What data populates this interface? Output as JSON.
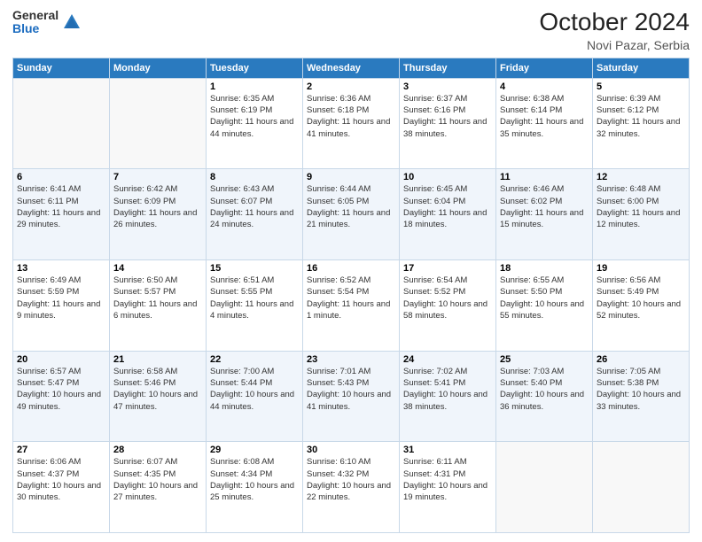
{
  "logo": {
    "general": "General",
    "blue": "Blue"
  },
  "title": "October 2024",
  "subtitle": "Novi Pazar, Serbia",
  "days_of_week": [
    "Sunday",
    "Monday",
    "Tuesday",
    "Wednesday",
    "Thursday",
    "Friday",
    "Saturday"
  ],
  "weeks": [
    [
      {
        "day": "",
        "sunrise": "",
        "sunset": "",
        "daylight": ""
      },
      {
        "day": "",
        "sunrise": "",
        "sunset": "",
        "daylight": ""
      },
      {
        "day": "1",
        "sunrise": "Sunrise: 6:35 AM",
        "sunset": "Sunset: 6:19 PM",
        "daylight": "Daylight: 11 hours and 44 minutes."
      },
      {
        "day": "2",
        "sunrise": "Sunrise: 6:36 AM",
        "sunset": "Sunset: 6:18 PM",
        "daylight": "Daylight: 11 hours and 41 minutes."
      },
      {
        "day": "3",
        "sunrise": "Sunrise: 6:37 AM",
        "sunset": "Sunset: 6:16 PM",
        "daylight": "Daylight: 11 hours and 38 minutes."
      },
      {
        "day": "4",
        "sunrise": "Sunrise: 6:38 AM",
        "sunset": "Sunset: 6:14 PM",
        "daylight": "Daylight: 11 hours and 35 minutes."
      },
      {
        "day": "5",
        "sunrise": "Sunrise: 6:39 AM",
        "sunset": "Sunset: 6:12 PM",
        "daylight": "Daylight: 11 hours and 32 minutes."
      }
    ],
    [
      {
        "day": "6",
        "sunrise": "Sunrise: 6:41 AM",
        "sunset": "Sunset: 6:11 PM",
        "daylight": "Daylight: 11 hours and 29 minutes."
      },
      {
        "day": "7",
        "sunrise": "Sunrise: 6:42 AM",
        "sunset": "Sunset: 6:09 PM",
        "daylight": "Daylight: 11 hours and 26 minutes."
      },
      {
        "day": "8",
        "sunrise": "Sunrise: 6:43 AM",
        "sunset": "Sunset: 6:07 PM",
        "daylight": "Daylight: 11 hours and 24 minutes."
      },
      {
        "day": "9",
        "sunrise": "Sunrise: 6:44 AM",
        "sunset": "Sunset: 6:05 PM",
        "daylight": "Daylight: 11 hours and 21 minutes."
      },
      {
        "day": "10",
        "sunrise": "Sunrise: 6:45 AM",
        "sunset": "Sunset: 6:04 PM",
        "daylight": "Daylight: 11 hours and 18 minutes."
      },
      {
        "day": "11",
        "sunrise": "Sunrise: 6:46 AM",
        "sunset": "Sunset: 6:02 PM",
        "daylight": "Daylight: 11 hours and 15 minutes."
      },
      {
        "day": "12",
        "sunrise": "Sunrise: 6:48 AM",
        "sunset": "Sunset: 6:00 PM",
        "daylight": "Daylight: 11 hours and 12 minutes."
      }
    ],
    [
      {
        "day": "13",
        "sunrise": "Sunrise: 6:49 AM",
        "sunset": "Sunset: 5:59 PM",
        "daylight": "Daylight: 11 hours and 9 minutes."
      },
      {
        "day": "14",
        "sunrise": "Sunrise: 6:50 AM",
        "sunset": "Sunset: 5:57 PM",
        "daylight": "Daylight: 11 hours and 6 minutes."
      },
      {
        "day": "15",
        "sunrise": "Sunrise: 6:51 AM",
        "sunset": "Sunset: 5:55 PM",
        "daylight": "Daylight: 11 hours and 4 minutes."
      },
      {
        "day": "16",
        "sunrise": "Sunrise: 6:52 AM",
        "sunset": "Sunset: 5:54 PM",
        "daylight": "Daylight: 11 hours and 1 minute."
      },
      {
        "day": "17",
        "sunrise": "Sunrise: 6:54 AM",
        "sunset": "Sunset: 5:52 PM",
        "daylight": "Daylight: 10 hours and 58 minutes."
      },
      {
        "day": "18",
        "sunrise": "Sunrise: 6:55 AM",
        "sunset": "Sunset: 5:50 PM",
        "daylight": "Daylight: 10 hours and 55 minutes."
      },
      {
        "day": "19",
        "sunrise": "Sunrise: 6:56 AM",
        "sunset": "Sunset: 5:49 PM",
        "daylight": "Daylight: 10 hours and 52 minutes."
      }
    ],
    [
      {
        "day": "20",
        "sunrise": "Sunrise: 6:57 AM",
        "sunset": "Sunset: 5:47 PM",
        "daylight": "Daylight: 10 hours and 49 minutes."
      },
      {
        "day": "21",
        "sunrise": "Sunrise: 6:58 AM",
        "sunset": "Sunset: 5:46 PM",
        "daylight": "Daylight: 10 hours and 47 minutes."
      },
      {
        "day": "22",
        "sunrise": "Sunrise: 7:00 AM",
        "sunset": "Sunset: 5:44 PM",
        "daylight": "Daylight: 10 hours and 44 minutes."
      },
      {
        "day": "23",
        "sunrise": "Sunrise: 7:01 AM",
        "sunset": "Sunset: 5:43 PM",
        "daylight": "Daylight: 10 hours and 41 minutes."
      },
      {
        "day": "24",
        "sunrise": "Sunrise: 7:02 AM",
        "sunset": "Sunset: 5:41 PM",
        "daylight": "Daylight: 10 hours and 38 minutes."
      },
      {
        "day": "25",
        "sunrise": "Sunrise: 7:03 AM",
        "sunset": "Sunset: 5:40 PM",
        "daylight": "Daylight: 10 hours and 36 minutes."
      },
      {
        "day": "26",
        "sunrise": "Sunrise: 7:05 AM",
        "sunset": "Sunset: 5:38 PM",
        "daylight": "Daylight: 10 hours and 33 minutes."
      }
    ],
    [
      {
        "day": "27",
        "sunrise": "Sunrise: 6:06 AM",
        "sunset": "Sunset: 4:37 PM",
        "daylight": "Daylight: 10 hours and 30 minutes."
      },
      {
        "day": "28",
        "sunrise": "Sunrise: 6:07 AM",
        "sunset": "Sunset: 4:35 PM",
        "daylight": "Daylight: 10 hours and 27 minutes."
      },
      {
        "day": "29",
        "sunrise": "Sunrise: 6:08 AM",
        "sunset": "Sunset: 4:34 PM",
        "daylight": "Daylight: 10 hours and 25 minutes."
      },
      {
        "day": "30",
        "sunrise": "Sunrise: 6:10 AM",
        "sunset": "Sunset: 4:32 PM",
        "daylight": "Daylight: 10 hours and 22 minutes."
      },
      {
        "day": "31",
        "sunrise": "Sunrise: 6:11 AM",
        "sunset": "Sunset: 4:31 PM",
        "daylight": "Daylight: 10 hours and 19 minutes."
      },
      {
        "day": "",
        "sunrise": "",
        "sunset": "",
        "daylight": ""
      },
      {
        "day": "",
        "sunrise": "",
        "sunset": "",
        "daylight": ""
      }
    ]
  ]
}
